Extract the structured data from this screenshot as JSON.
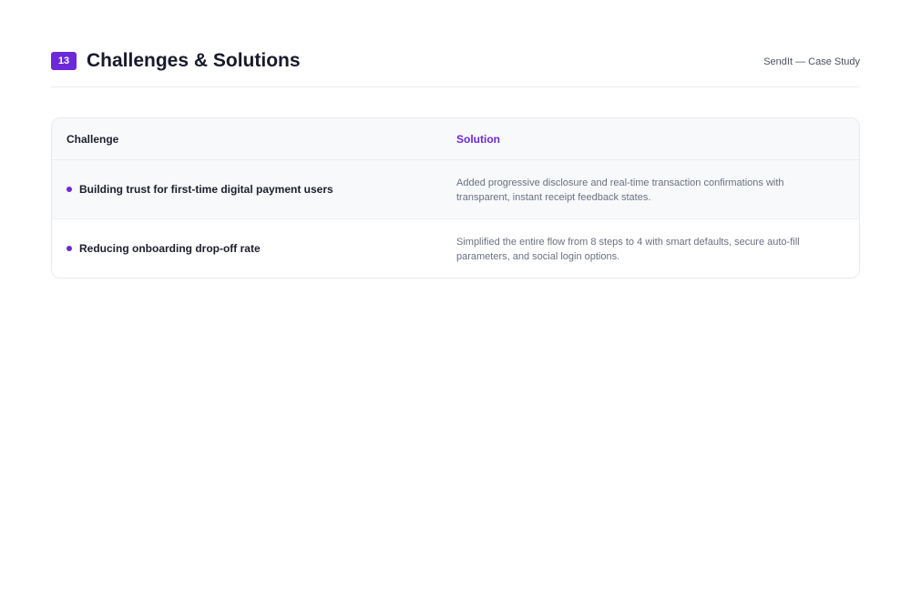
{
  "header": {
    "slide_number": "13",
    "title": "Challenges & Solutions",
    "document_label": "SendIt — Case Study"
  },
  "table": {
    "columns": [
      "Challenge",
      "Solution"
    ],
    "rows": [
      {
        "challenge": "Building trust for first-time digital payment users",
        "solution": "Added progressive disclosure and real-time transaction confirmations with transparent, instant receipt feedback states."
      },
      {
        "challenge": "Reducing onboarding drop-off rate",
        "solution": "Simplified the entire flow from 8 steps to 4 with smart defaults, secure auto-fill parameters, and social login options."
      }
    ]
  },
  "colors": {
    "accent": "#6d28d9",
    "title": "#181a2a",
    "muted_text": "#6b7080",
    "header_row_bg": "#f8f9fb"
  },
  "icons": {
    "row_bullet": "bullet-dot-icon"
  }
}
